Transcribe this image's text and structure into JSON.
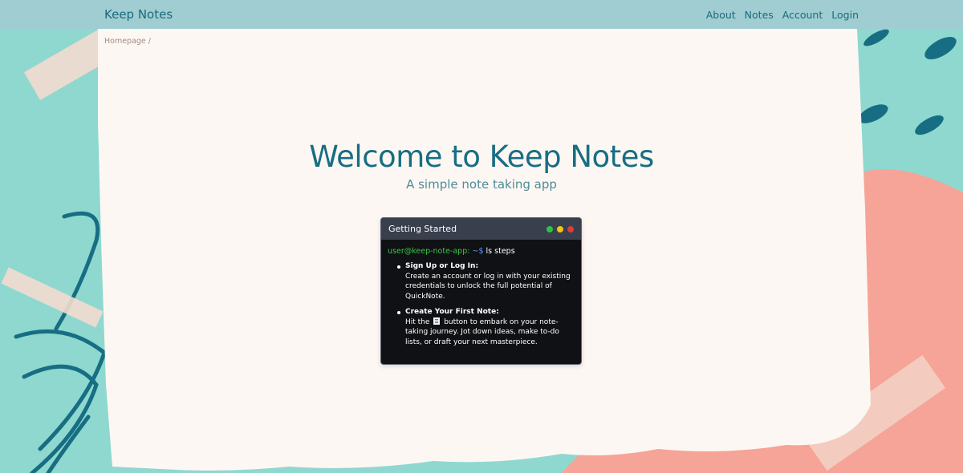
{
  "navbar": {
    "brand": "Keep Notes",
    "links": [
      {
        "label": "About"
      },
      {
        "label": "Notes"
      },
      {
        "label": "Account"
      },
      {
        "label": "Login"
      }
    ]
  },
  "breadcrumb": {
    "label": "Homepage /"
  },
  "hero": {
    "title": "Welcome to Keep Notes",
    "subtitle": "A simple note taking app"
  },
  "terminal": {
    "title": "Getting Started",
    "dot_colors": [
      "#2fc24b",
      "#f1c40f",
      "#e53935"
    ],
    "prompt_user": "user@keep-note-app:",
    "prompt_path": "~$",
    "prompt_command": "ls steps",
    "steps": [
      {
        "title": "Sign Up or Log In:",
        "text": "Create an account or log in with your existing credentials to unlock the full potential of QuickNote."
      },
      {
        "title": "Create Your First Note:",
        "text_before": "Hit the",
        "icon": "note-icon",
        "text_after": "button to embark on your note-taking journey. Jot down ideas, make to-do lists, or draft your next masterpiece."
      }
    ]
  },
  "colors": {
    "navbar_bg": "#9fcdd2",
    "brand": "#1c6a7a",
    "title": "#176e83",
    "paper": "#fdf7f3",
    "teal_bg": "#8fd8cf",
    "coral_bg": "#f5a497"
  }
}
